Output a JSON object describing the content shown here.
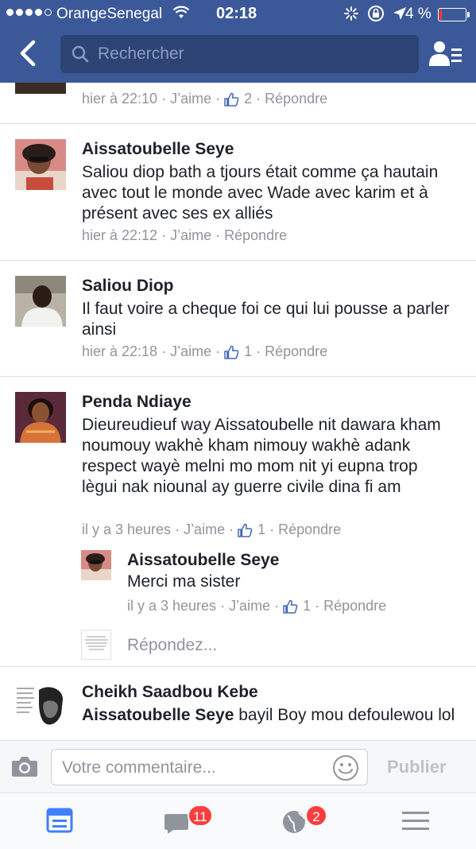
{
  "status_bar": {
    "carrier": "OrangeSenegal",
    "time": "02:18",
    "battery_percent": "4 %"
  },
  "header": {
    "search_placeholder": "Rechercher"
  },
  "comments": [
    {
      "meta": {
        "time": "hier à 22:10",
        "like_label": "J’aime",
        "like_count": "2",
        "reply_label": "Répondre"
      }
    },
    {
      "author": "Aissatoubelle Seye",
      "text": "Saliou diop bath a tjours était comme ça hautain avec tout le monde avec Wade avec karim et à présent avec ses ex alliés",
      "meta": {
        "time": "hier à 22:12",
        "like_label": "J’aime",
        "reply_label": "Répondre"
      }
    },
    {
      "author": "Saliou Diop",
      "text": "Il faut voire a cheque foi ce qui lui pousse a parler ainsi",
      "meta": {
        "time": "hier à 22:18",
        "like_label": "J’aime",
        "like_count": "1",
        "reply_label": "Répondre"
      }
    },
    {
      "author": "Penda Ndiaye",
      "text": "Dieureudieuf way Aissatoubelle nit dawara kham noumouy wakhè kham nimouy wakhè adank respect wayè melni mo mom nit yi eupna trop lègui nak niounal ay guerre civile dina fi am",
      "meta": {
        "time": "il y a 3 heures",
        "like_label": "J’aime",
        "like_count": "1",
        "reply_label": "Répondre"
      },
      "replies": [
        {
          "author": "Aissatoubelle Seye",
          "text": "Merci ma sister",
          "meta": {
            "time": "il y a 3 heures",
            "like_label": "J’aime",
            "like_count": "1",
            "reply_label": "Répondre"
          }
        }
      ],
      "reply_placeholder": "Répondez..."
    },
    {
      "author": "Cheikh Saadbou Kebe",
      "mention": "Aissatoubelle Seye",
      "text": " bayil Boy mou defoulewou lol"
    }
  ],
  "composer": {
    "placeholder": "Votre commentaire...",
    "publish_label": "Publier"
  },
  "tabbar": {
    "messages_badge": "11",
    "notifications_badge": "2"
  },
  "colors": {
    "brand": "#3b5998",
    "badge": "#fa3e3e",
    "tab_active": "#4080ff"
  }
}
